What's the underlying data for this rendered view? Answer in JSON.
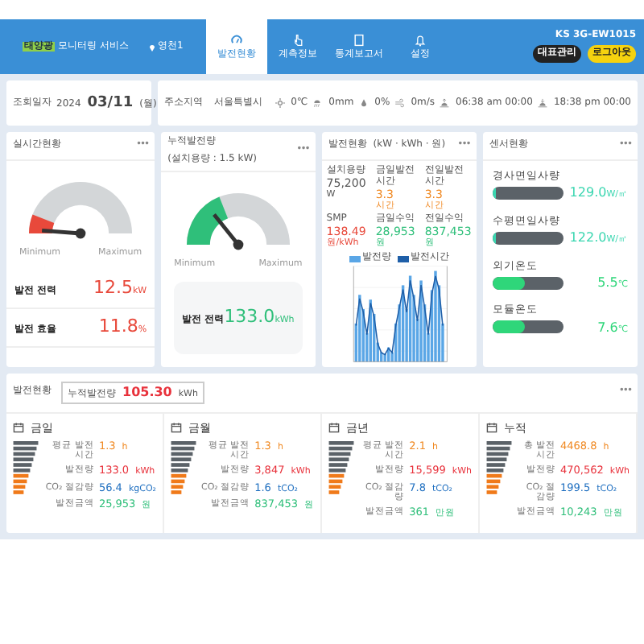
{
  "header": {
    "logo_badge": "태양광",
    "logo_text": "모니터링 서비스",
    "site": "영천1",
    "tabs": [
      {
        "label": "발전현황",
        "selected": true
      },
      {
        "label": "계측정보",
        "selected": false
      },
      {
        "label": "통계보고서",
        "selected": false
      },
      {
        "label": "설정",
        "selected": false
      }
    ],
    "user": "KS 3G-EW1015",
    "buttons": [
      {
        "label": "대표관리",
        "kind": "dark"
      },
      {
        "label": "로그아웃",
        "kind": "yellow"
      }
    ]
  },
  "date_card": {
    "label": "조회일자",
    "year": "2024",
    "date": "03/11",
    "weekday": "(월)"
  },
  "location_card": {
    "label": "주소지역",
    "value": "서울특별시",
    "weather": [
      "0℃",
      "0mm",
      "0%",
      "0m/s",
      "06:38 am 00:00",
      "18:38 pm 00:00"
    ]
  },
  "realtime_card": {
    "title": "실시간현황",
    "more": "•••",
    "min": "Minimum",
    "max": "Maximum",
    "rows": [
      {
        "label": "발전 전력",
        "value": "12.5",
        "unit": "kW"
      },
      {
        "label": "발전 효율",
        "value": "11.8",
        "unit": "%"
      }
    ]
  },
  "total_card": {
    "title": "누적발전량",
    "subtitle": "(설치용량 : 1.5 kW)",
    "more": "•••",
    "min": "Minimum",
    "max": "Maximum",
    "row": {
      "label": "발전 전력",
      "value": "133.0",
      "unit": "kWh"
    }
  },
  "chart_card": {
    "title": "발전현황",
    "subtitle": "(kW · kWh · 원)",
    "more": "•••",
    "stats": [
      {
        "label": "설치용량",
        "value": "75,200",
        "unit": "W"
      },
      {
        "label": "금일발전시간",
        "value": "3.3",
        "unit": "시간"
      },
      {
        "label": "전일발전시간",
        "value": "3.3",
        "unit": "시간"
      },
      {
        "label": "SMP",
        "value": "138.49",
        "unit": "원/kWh"
      },
      {
        "label": "금일수익",
        "value": "28,953",
        "unit": "원"
      },
      {
        "label": "전일수익",
        "value": "837,453",
        "unit": "원"
      }
    ],
    "legend": [
      {
        "label": "발전량",
        "color": "#5aa6e6"
      },
      {
        "label": "발전시간",
        "color": "#1f5fa8"
      }
    ]
  },
  "sensor_card": {
    "title": "센서현황",
    "more": "•••",
    "items": [
      {
        "label": "경사면일사량",
        "value": "129.0",
        "unit": "W/㎡",
        "level": 0.06
      },
      {
        "label": "수평면일사량",
        "value": "122.0",
        "unit": "W/㎡",
        "level": 0.06
      },
      {
        "label": "외기온도",
        "value": "5.5",
        "unit": "℃",
        "level": 0.45
      },
      {
        "label": "모듈온도",
        "value": "7.6",
        "unit": "℃",
        "level": 0.45
      }
    ]
  },
  "summary": {
    "title": "발전현황",
    "total_label": "누적발전량",
    "total_value": "105.30",
    "total_unit": "kWh",
    "more": "•••",
    "panels": [
      {
        "title": "금일",
        "rows": [
          {
            "label": "평균 발전시간",
            "value": "1.3",
            "unit": "h"
          },
          {
            "label": "발전량",
            "value": "133.0",
            "unit": "kWh"
          },
          {
            "label": "CO₂ 절감량",
            "value": "56.4",
            "unit": "kgCO₂"
          },
          {
            "label": "발전금액",
            "value": "25,953",
            "unit": "원"
          }
        ]
      },
      {
        "title": "금월",
        "rows": [
          {
            "label": "평균 발전시간",
            "value": "1.3",
            "unit": "h"
          },
          {
            "label": "발전량",
            "value": "3,847",
            "unit": "kWh"
          },
          {
            "label": "CO₂ 절감량",
            "value": "1.6",
            "unit": "tCO₂"
          },
          {
            "label": "발전금액",
            "value": "837,453",
            "unit": "원"
          }
        ]
      },
      {
        "title": "금년",
        "rows": [
          {
            "label": "평균 발전시간",
            "value": "2.1",
            "unit": "h"
          },
          {
            "label": "발전량",
            "value": "15,599",
            "unit": "kWh"
          },
          {
            "label": "CO₂ 절감량",
            "value": "7.8",
            "unit": "tCO₂"
          },
          {
            "label": "발전금액",
            "value": "361",
            "unit": "만원"
          }
        ]
      },
      {
        "title": "누적",
        "rows": [
          {
            "label": "총 발전시간",
            "value": "4468.8",
            "unit": "h"
          },
          {
            "label": "발전량",
            "value": "470,562",
            "unit": "kWh"
          },
          {
            "label": "CO₂ 절감량",
            "value": "199.5",
            "unit": "tCO₂"
          },
          {
            "label": "발전금액",
            "value": "10,243",
            "unit": "만원"
          }
        ]
      }
    ]
  }
}
